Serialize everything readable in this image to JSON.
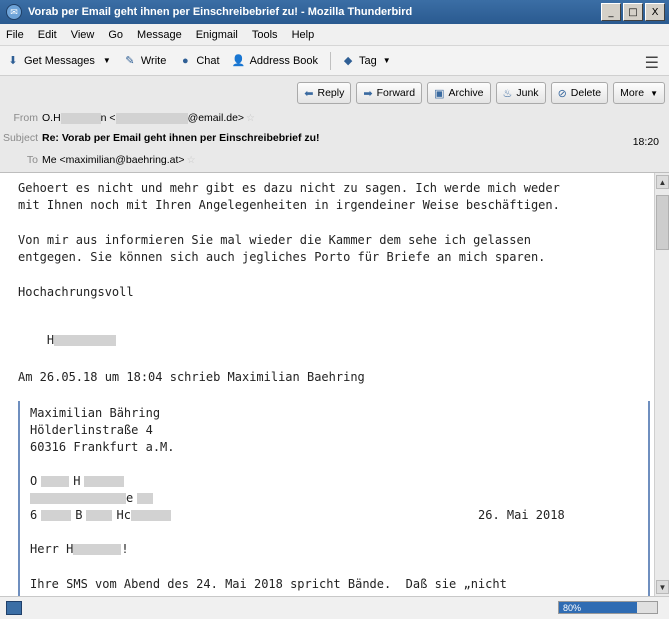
{
  "window": {
    "title": "Vorab per Email geht ihnen per Einschreibebrief zu! - Mozilla Thunderbird",
    "buttons": [
      "_",
      "□",
      "X"
    ]
  },
  "menubar": [
    "File",
    "Edit",
    "View",
    "Go",
    "Message",
    "Enigmail",
    "Tools",
    "Help"
  ],
  "toolbar": {
    "get_messages": "Get Messages",
    "write": "Write",
    "chat": "Chat",
    "address_book": "Address Book",
    "tag": "Tag"
  },
  "actions": {
    "reply": "Reply",
    "forward": "Forward",
    "archive": "Archive",
    "junk": "Junk",
    "delete": "Delete",
    "more": "More"
  },
  "header": {
    "from_label": "From",
    "from_prefix": "O.H",
    "from_mid": "n <",
    "from_domain": "@email.de>",
    "subject_label": "Subject",
    "subject": "Re: Vorab per Email geht ihnen per Einschreibebrief zu!",
    "time": "18:20",
    "to_label": "To",
    "to": "Me <maximilian@baehring.at>"
  },
  "body": {
    "line1": "Gehoert es nicht und mehr gibt es dazu nicht zu sagen. Ich werde mich weder",
    "line2": "mit Ihnen noch mit Ihren Angelegenheiten in irgendeiner Weise beschäftigen.",
    "line3": "Von mir aus informieren Sie mal wieder die Kammer dem sehe ich gelassen",
    "line4": "entgegen. Sie können sich auch jegliches Porto für Briefe an mich sparen.",
    "closing": "Hochachrungsvoll",
    "sig": "H",
    "quote_intro": "Am 26.05.18 um 18:04 schrieb Maximilian Baehring"
  },
  "quote": {
    "name": "Maximilian Bähring",
    "street": "Hölderlinstraße 4",
    "city": "60316 Frankfurt a.M.",
    "r1_a": "O",
    "r1_b": "H",
    "r2_tail": "e",
    "r3_a": "6",
    "r3_b": "B",
    "r3_c": "Hc",
    "date": "26. Mai 2018",
    "salutation_a": "Herr H",
    "salutation_b": "!",
    "text1": "Ihre SMS vom Abend des 24. Mai 2018 spricht Bände.  Daß sie „nicht"
  },
  "status": {
    "progress_percent": 80,
    "progress_label": "80%"
  },
  "colors": {
    "title_bar": "#2f5f95",
    "quote_border": "#6f8fbf"
  }
}
